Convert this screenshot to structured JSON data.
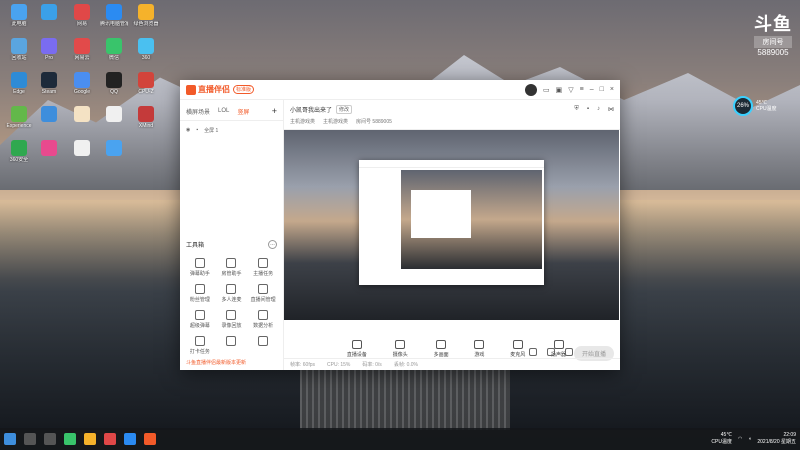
{
  "watermark": {
    "brand_mark": "斗鱼",
    "sub": "房间号",
    "room_no": "5889005"
  },
  "desktop_icons": [
    {
      "label": "此电脑",
      "color": "#4aa3f0"
    },
    {
      "label": "",
      "color": "#3ba0e8"
    },
    {
      "label": "网易",
      "color": "#e04848"
    },
    {
      "label": "腾讯电脑管家",
      "color": "#2b8bf2"
    },
    {
      "label": "绿色浏览器",
      "color": "#f5b22b"
    },
    {
      "label": "回收站",
      "color": "#5aa5e0"
    },
    {
      "label": "Pro",
      "color": "#7a6cf0"
    },
    {
      "label": "网易云",
      "color": "#e24a4a"
    },
    {
      "label": "微信",
      "color": "#39c46b"
    },
    {
      "label": "360",
      "color": "#4ac0f0"
    },
    {
      "label": "Edge",
      "color": "#2e8bd6"
    },
    {
      "label": "Steam",
      "color": "#1d2a3a"
    },
    {
      "label": "Google",
      "color": "#4a8ef0"
    },
    {
      "label": "QQ",
      "color": "#222222"
    },
    {
      "label": "CPU-Z",
      "color": "#d2443b"
    },
    {
      "label": "Experience",
      "color": "#63b84a"
    },
    {
      "label": "",
      "color": "#3e8edc"
    },
    {
      "label": "",
      "color": "#f4e2c4"
    },
    {
      "label": "",
      "color": "#f0f0f0"
    },
    {
      "label": "XMind",
      "color": "#c43a3a"
    },
    {
      "label": "360安全",
      "color": "#2fa84f"
    },
    {
      "label": "",
      "color": "#e84a8e"
    },
    {
      "label": "",
      "color": "#f0f0f0"
    },
    {
      "label": "",
      "color": "#4aa3f0"
    }
  ],
  "cpu_widget": {
    "percent": "26%",
    "temp": "45℃",
    "label": "CPU温度"
  },
  "app": {
    "brand": "直播伴侣",
    "badge": "标准版",
    "left_tabs": [
      "横屏场景",
      "LOL",
      "竖屏"
    ],
    "left_active_index": 2,
    "scene_row": [
      "全屏 1"
    ],
    "tools_title": "工具箱",
    "tools": [
      "弹幕助手",
      "房管助手",
      "主播任务",
      "粉丝管理",
      "多人连麦",
      "直播间管理",
      "超级弹幕",
      "录像回放",
      "数据分析",
      "打卡任务",
      "",
      ""
    ],
    "notice": "斗鱼直播伴侣最新版本更新",
    "room_title": "小凯哥我出来了",
    "edit_label": "修改",
    "room_info": [
      "主机游戏类",
      "主机游戏类",
      "房间号 5889005"
    ],
    "controls": [
      "直播设备",
      "摄像头",
      "多画面",
      "游戏",
      "麦克风",
      "扬声器"
    ],
    "start_live": "开始直播",
    "status": [
      "帧率: 60fps",
      "CPU: 15%",
      "码率: 0/s",
      "丢帧: 0.0%"
    ]
  },
  "taskbar": {
    "time": "22:09",
    "date": "2021/8/20 星期五",
    "temp_label": "45℃",
    "cpu_label": "CPU温度"
  }
}
